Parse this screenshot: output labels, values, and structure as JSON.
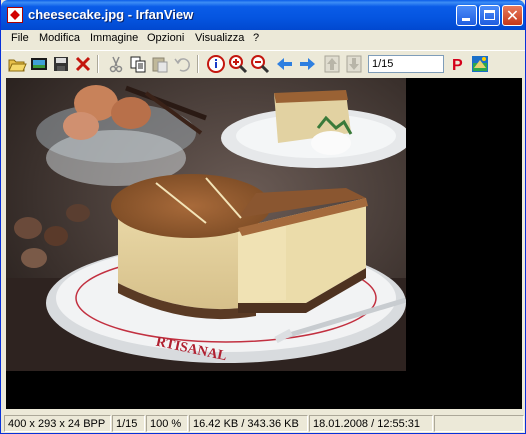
{
  "window": {
    "title": "cheesecake.jpg - IrfanView"
  },
  "menu": {
    "items": [
      "File",
      "Modifica",
      "Immagine",
      "Opzioni",
      "Visualizza",
      "?"
    ]
  },
  "toolbar": {
    "buttons": [
      "open-icon",
      "slideshow-icon",
      "save-icon",
      "delete-icon",
      "cut-icon",
      "copy-icon",
      "paste-icon",
      "undo-icon",
      "info-icon",
      "zoom-in-icon",
      "zoom-out-icon",
      "previous-icon",
      "next-icon",
      "first-icon",
      "last-icon",
      "print-icon",
      "paint-icon"
    ],
    "page_value": "1/15"
  },
  "colors": {
    "titlebar": "#0555e0",
    "chrome": "#ece9d8",
    "viewport": "#000000"
  },
  "status": {
    "dimensions": "400 x 293 x 24 BPP",
    "page": "1/15",
    "zoom": "100 %",
    "size": "16.42 KB / 343.36 KB",
    "datetime": "18.01.2008 / 12:55:31"
  },
  "photo": {
    "plate_text": "RTISANAL"
  }
}
